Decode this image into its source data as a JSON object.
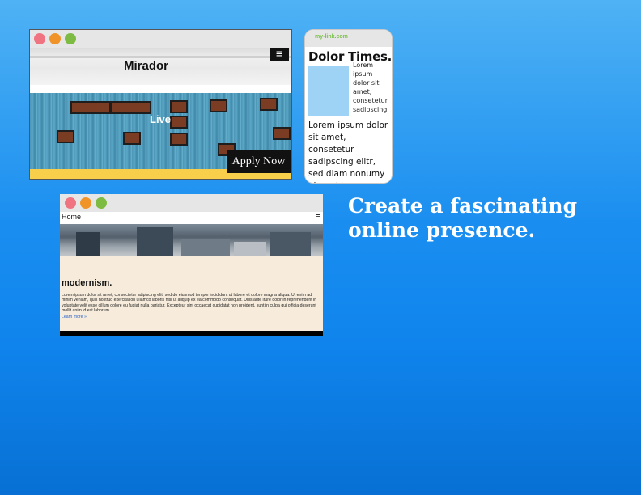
{
  "window1": {
    "brand": "Mirador",
    "subtitle": "Live",
    "cta_label": "Apply Now",
    "menu_icon": "≡",
    "colors": {
      "accent_bar": "#f7cf4a",
      "building": "#5aa8c8"
    }
  },
  "window2": {
    "url": "my-link.com",
    "title": "Dolor Times.",
    "side_text": "Lorem ipsum dolor sit amet, consetetur sadipscing",
    "body_text": "Lorem ipsum dolor sit amet, consetetur sadipscing elitr, sed diam nonumy eirmod tempor"
  },
  "window3": {
    "nav_home": "Home",
    "menu_icon": "≡",
    "heading": "modernism.",
    "paragraph": "Lorem ipsum dolor sit amet, consectetur adipiscing elit, sed do eiusmod tempor incididunt ut labore et dolore magna aliqua. Ut enim ad minim veniam, quis nostrud exercitation ullamco laboris nisi ut aliquip ex ea commodo consequat. Duis aute irure dolor in reprehenderit in voluptate velit esse cillum dolore eu fugiat nulla pariatur. Excepteur sint occaecat cupidatat non proident, sunt in culpa qui officia deserunt mollit anim id est laborum.",
    "learn_more": "Learn more »"
  },
  "tagline": "Create a fascinating online presence.",
  "colors": {
    "background": "#1a8ef0",
    "dot_red": "#ef7381",
    "dot_orange": "#f0942a",
    "dot_green": "#7dbb43"
  }
}
